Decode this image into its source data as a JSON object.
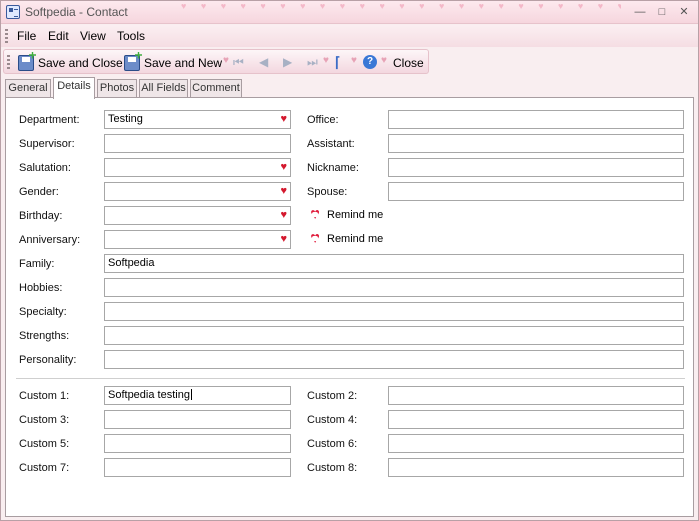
{
  "window": {
    "title": "Softpedia - Contact",
    "hearts": "♥ ♥ ♥ ♥ ♥ ♥ ♥ ♥ ♥ ♥ ♥ ♥ ♥ ♥ ♥ ♥ ♥ ♥ ♥ ♥ ♥ ♥ ♥ ♥ ♥ ♥ ♥ ♥ ♥ ♥"
  },
  "menu": {
    "file": "File",
    "edit": "Edit",
    "view": "View",
    "tools": "Tools"
  },
  "toolbar": {
    "save_close": "Save and Close",
    "save_new": "Save and New",
    "close": "Close",
    "help_glyph": "?"
  },
  "tabs": [
    "General",
    "Details",
    "Photos",
    "All Fields",
    "Comment"
  ],
  "fields": {
    "department": {
      "label": "Department:",
      "value": "Testing"
    },
    "office": {
      "label": "Office:",
      "value": ""
    },
    "supervisor": {
      "label": "Supervisor:",
      "value": ""
    },
    "assistant": {
      "label": "Assistant:",
      "value": ""
    },
    "salutation": {
      "label": "Salutation:",
      "value": ""
    },
    "nickname": {
      "label": "Nickname:",
      "value": ""
    },
    "gender": {
      "label": "Gender:",
      "value": ""
    },
    "spouse": {
      "label": "Spouse:",
      "value": ""
    },
    "birthday": {
      "label": "Birthday:",
      "value": ""
    },
    "anniversary": {
      "label": "Anniversary:",
      "value": ""
    },
    "family": {
      "label": "Family:",
      "value": "Softpedia"
    },
    "hobbies": {
      "label": "Hobbies:",
      "value": ""
    },
    "specialty": {
      "label": "Specialty:",
      "value": ""
    },
    "strengths": {
      "label": "Strengths:",
      "value": ""
    },
    "personality": {
      "label": "Personality:",
      "value": ""
    },
    "custom1": {
      "label": "Custom 1:",
      "value": "Softpedia testing"
    },
    "custom2": {
      "label": "Custom 2:",
      "value": ""
    },
    "custom3": {
      "label": "Custom 3:",
      "value": ""
    },
    "custom4": {
      "label": "Custom 4:",
      "value": ""
    },
    "custom5": {
      "label": "Custom 5:",
      "value": ""
    },
    "custom6": {
      "label": "Custom 6:",
      "value": ""
    },
    "custom7": {
      "label": "Custom 7:",
      "value": ""
    },
    "custom8": {
      "label": "Custom 8:",
      "value": ""
    }
  },
  "remind_me": "Remind me",
  "accent_heart_color": "#d4192e"
}
